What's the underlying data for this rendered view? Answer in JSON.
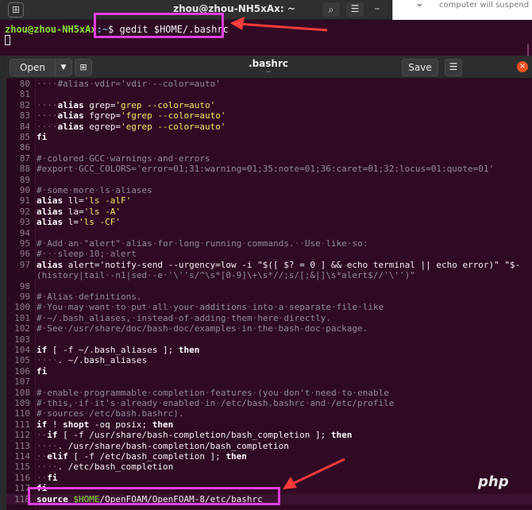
{
  "terminal": {
    "title": "zhou@zhou-NH5xAx: ~",
    "prompt_user": "zhou@zhou-NH5xAx",
    "prompt_path": ":~",
    "prompt_symbol": "$",
    "command": " gedit $HOME/.bashrc"
  },
  "notification": {
    "text": "computer will suspend"
  },
  "gedit": {
    "open_label": "Open",
    "doc_title": ".bashrc",
    "doc_subtitle": "~",
    "save_label": "Save"
  },
  "lines": [
    {
      "n": "80",
      "t": "    #alias vdir='vdir --color=auto'"
    },
    {
      "n": "81",
      "t": ""
    },
    {
      "n": "82",
      "t": "    alias grep='grep --color=auto'"
    },
    {
      "n": "83",
      "t": "    alias fgrep='fgrep --color=auto'"
    },
    {
      "n": "84",
      "t": "    alias egrep='egrep --color=auto'"
    },
    {
      "n": "85",
      "t": "fi"
    },
    {
      "n": "86",
      "t": ""
    },
    {
      "n": "87",
      "t": "# colored GCC warnings and errors"
    },
    {
      "n": "88",
      "t": "#export GCC_COLORS='error=01;31:warning=01;35:note=01;36:caret=01;32:locus=01:quote=01'"
    },
    {
      "n": "89",
      "t": ""
    },
    {
      "n": "90",
      "t": "# some more ls aliases"
    },
    {
      "n": "91",
      "t": "alias ll='ls -alF'"
    },
    {
      "n": "92",
      "t": "alias la='ls -A'"
    },
    {
      "n": "93",
      "t": "alias l='ls -CF'"
    },
    {
      "n": "94",
      "t": ""
    },
    {
      "n": "95",
      "t": "# Add an \"alert\" alias for long running commands.  Use like so:"
    },
    {
      "n": "96",
      "t": "#   sleep 10; alert"
    },
    {
      "n": "97",
      "t": "alias alert='notify-send --urgency=low -i \"$([ $? = 0 ] && echo terminal || echo error)\" \"$-"
    },
    {
      "n": "",
      "t": "(history|tail -n1|sed -e '\\''s/^\\s*[0-9]\\+\\s*//;s/[;&|]\\s*alert$//'\\'')\""
    },
    {
      "n": "98",
      "t": ""
    },
    {
      "n": "99",
      "t": "# Alias definitions."
    },
    {
      "n": "100",
      "t": "# You may want to put all your additions into a separate file like"
    },
    {
      "n": "101",
      "t": "# ~/.bash_aliases, instead of adding them here directly."
    },
    {
      "n": "102",
      "t": "# See /usr/share/doc/bash-doc/examples in the bash-doc package."
    },
    {
      "n": "103",
      "t": ""
    },
    {
      "n": "104",
      "t": "if [ -f ~/.bash_aliases ]; then"
    },
    {
      "n": "105",
      "t": "    . ~/.bash_aliases"
    },
    {
      "n": "106",
      "t": "fi"
    },
    {
      "n": "107",
      "t": ""
    },
    {
      "n": "108",
      "t": "# enable programmable completion features (you don't need to enable"
    },
    {
      "n": "109",
      "t": "# this, if it's already enabled in /etc/bash.bashrc and /etc/profile"
    },
    {
      "n": "110",
      "t": "# sources /etc/bash.bashrc)."
    },
    {
      "n": "111",
      "t": "if ! shopt -oq posix; then"
    },
    {
      "n": "112",
      "t": "  if [ -f /usr/share/bash-completion/bash_completion ]; then"
    },
    {
      "n": "113",
      "t": "    . /usr/share/bash-completion/bash_completion"
    },
    {
      "n": "114",
      "t": "  elif [ -f /etc/bash_completion ]; then"
    },
    {
      "n": "115",
      "t": "    . /etc/bash_completion"
    },
    {
      "n": "116",
      "t": "  fi"
    },
    {
      "n": "117",
      "t": "fi"
    },
    {
      "n": "118",
      "t": "source $HOME/OpenFOAM/OpenFOAM-8/etc/bashrc"
    }
  ],
  "watermark": "php",
  "colors": {
    "terminal_bg": "#300a24",
    "annotation": "#e33fe3",
    "arrow": "#ff3b3b"
  }
}
